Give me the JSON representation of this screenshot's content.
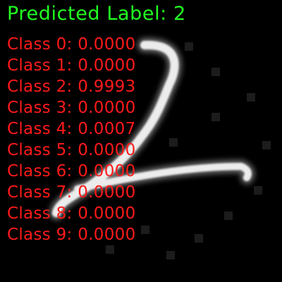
{
  "title": {
    "prefix": "Predicted Label:",
    "value": "2",
    "color": "#22ff22"
  },
  "probabilities": {
    "color": "#ff1a1a",
    "rows": [
      {
        "label": "Class 0:",
        "value": "0.0000"
      },
      {
        "label": "Class 1:",
        "value": "0.0000"
      },
      {
        "label": "Class 2:",
        "value": "0.9993"
      },
      {
        "label": "Class 3:",
        "value": "0.0000"
      },
      {
        "label": "Class 4:",
        "value": "0.0007"
      },
      {
        "label": "Class 5:",
        "value": "0.0000"
      },
      {
        "label": "Class 6:",
        "value": "0.0000"
      },
      {
        "label": "Class 7:",
        "value": "0.0000"
      },
      {
        "label": "Class 8:",
        "value": "0.0000"
      },
      {
        "label": "Class 9:",
        "value": "0.0000"
      }
    ]
  }
}
